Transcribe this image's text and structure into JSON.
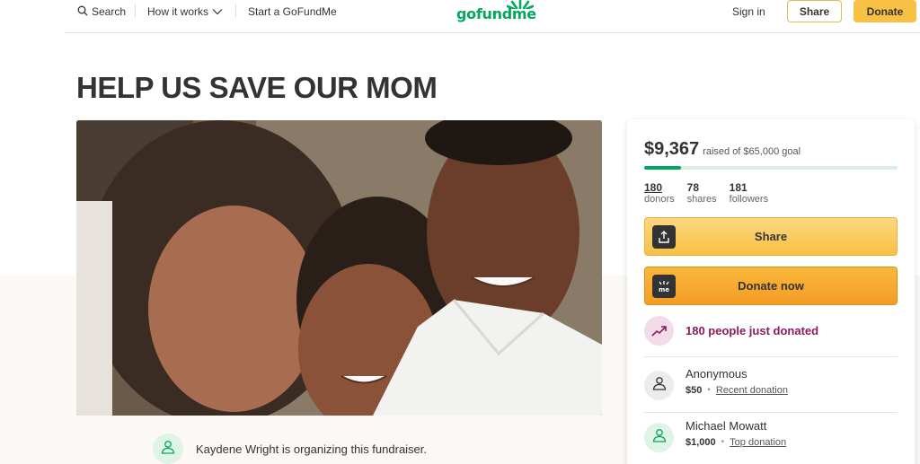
{
  "header": {
    "search_label": "Search",
    "how_it_works_label": "How it works",
    "start_label": "Start a GoFundMe",
    "logo_text": "gofundme",
    "signin_label": "Sign in",
    "share_label": "Share",
    "donate_label": "Donate"
  },
  "campaign": {
    "title": "HELP US SAVE OUR MOM",
    "organizer_text": "Kaydene Wright is organizing this fundraiser."
  },
  "progress": {
    "raised": "$9,367",
    "goal_text": "raised of $65,000 goal",
    "fraction": 0.144
  },
  "stats": [
    {
      "value": "180",
      "label": "donors"
    },
    {
      "value": "78",
      "label": "shares"
    },
    {
      "value": "181",
      "label": "followers"
    }
  ],
  "actions": {
    "share_label": "Share",
    "donate_label": "Donate now"
  },
  "trend": {
    "text": "180 people just donated"
  },
  "donations": [
    {
      "name": "Anonymous",
      "amount": "$50",
      "tag": "Recent donation"
    },
    {
      "name": "Michael Mowatt",
      "amount": "$1,000",
      "tag": "Top donation"
    }
  ],
  "colors": {
    "brand_green": "#02a95c",
    "donate_orange": "#f49c26",
    "share_yellow": "#f8c143",
    "trend_purple": "#8a1b5e"
  }
}
